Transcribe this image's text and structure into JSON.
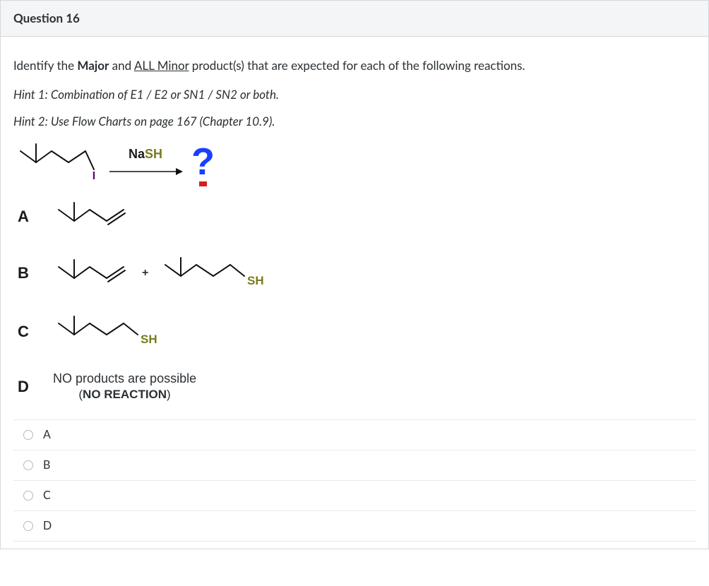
{
  "header": {
    "title": "Question 16"
  },
  "prompt": {
    "pre": "Identify the ",
    "major": "Major",
    "mid": " and ",
    "minor": "ALL Minor",
    "post": " product(s) that are expected for each of the following reactions."
  },
  "hints": [
    {
      "label": "Hint 1",
      "text": ": Combination of E1 / E2 or SN1 / SN2 or both."
    },
    {
      "label": "Hint 2",
      "text": ": Use Flow Charts on page 167 (Chapter 10.9)."
    }
  ],
  "reaction": {
    "reagent_na": "Na",
    "reagent_sh": "SH",
    "substrate_leaving_group": "I",
    "product_placeholder": "?"
  },
  "image_choices": {
    "A": {
      "label": "A",
      "desc": "alkene (elimination product)"
    },
    "B": {
      "label": "B",
      "desc": "alkene + thiol substitution product",
      "plus": "+",
      "sh": "SH"
    },
    "C": {
      "label": "C",
      "desc": "thiol substitution product",
      "sh": "SH"
    },
    "D": {
      "label": "D",
      "line1": "NO products are possible",
      "line2_pre": "(",
      "line2_bold": "NO REACTION",
      "line2_post": ")"
    }
  },
  "answer_options": [
    {
      "value": "A",
      "label": "A"
    },
    {
      "value": "B",
      "label": "B"
    },
    {
      "value": "C",
      "label": "C"
    },
    {
      "value": "D",
      "label": "D"
    }
  ]
}
